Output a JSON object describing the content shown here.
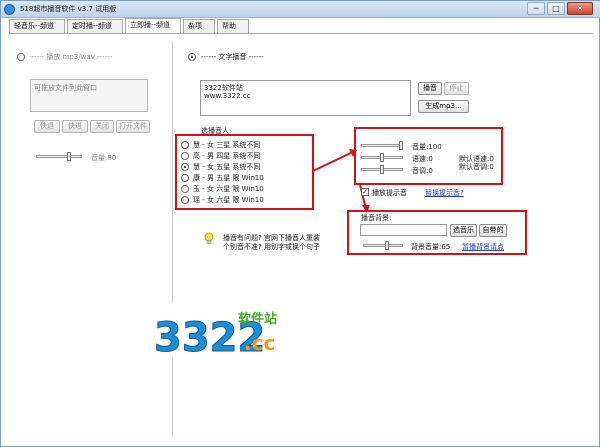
{
  "window": {
    "title": "518超市播音软件 v3.7 试用版",
    "minimize": "─",
    "maximize": "□",
    "close": "✕"
  },
  "tabs": [
    {
      "label": "轻音乐--频道"
    },
    {
      "label": "定时播--频道"
    },
    {
      "label": "立即播--频道"
    },
    {
      "label": "杂项"
    },
    {
      "label": "帮助"
    }
  ],
  "left": {
    "section_label": "------ 播放 mp3/wav ------",
    "drop_hint": "可拖放文件到此窗口",
    "buttons": [
      "快退",
      "快进",
      "关闭",
      "打开文件"
    ],
    "volume_label": "音量:80"
  },
  "right": {
    "section_label": "------ 文字播音 ------",
    "text_content_line1": "3322软件站",
    "text_content_line2": "www.3322.cc",
    "play_button": "播音",
    "stop_button": "停止",
    "mp3_button": "生成mp3...",
    "speaker_label": "选播音人:",
    "voices": [
      {
        "label": "慧 - 女 三星 系统不同",
        "selected": false
      },
      {
        "label": "高 - 男 四星 系统不同",
        "selected": false
      },
      {
        "label": "慧 - 女 五星 系统不同",
        "selected": true
      },
      {
        "label": "康 - 男 五星 限 Win10",
        "selected": false
      },
      {
        "label": "玉 - 女 六星 限 Win10",
        "selected": false
      },
      {
        "label": "瑶 - 女 六星 限 Win10",
        "selected": false
      }
    ],
    "volume_label": "音量:100",
    "speed_label": "语速:0",
    "pitch_label": "音调:0",
    "default_speed": "默认语速:0",
    "default_pitch": "默认音调:0",
    "prompt_checkbox": "播放提示音",
    "prompt_checked": true,
    "change_prompt_link": "替换提示音?",
    "bg_label": "播音背景:",
    "choose_music_button": "选音乐",
    "builtin_button": "自带的",
    "bg_volume_label": "背景音量:65",
    "stop_bg_link": "暂播背景请点",
    "tip_line1": "播音有问题? 官网下播音人重装",
    "tip_line2": "个别音不准? 用别字或换个句子"
  },
  "logo": {
    "digits": "3322",
    "suffix": ".cc",
    "tagline": "软件站"
  },
  "colors": {
    "annotation_red": "#d0121a",
    "link_blue": "#1f3fbf",
    "logo_blue": "#1a8fd8",
    "logo_orange": "#f29a12",
    "logo_green": "#4caa2b"
  }
}
